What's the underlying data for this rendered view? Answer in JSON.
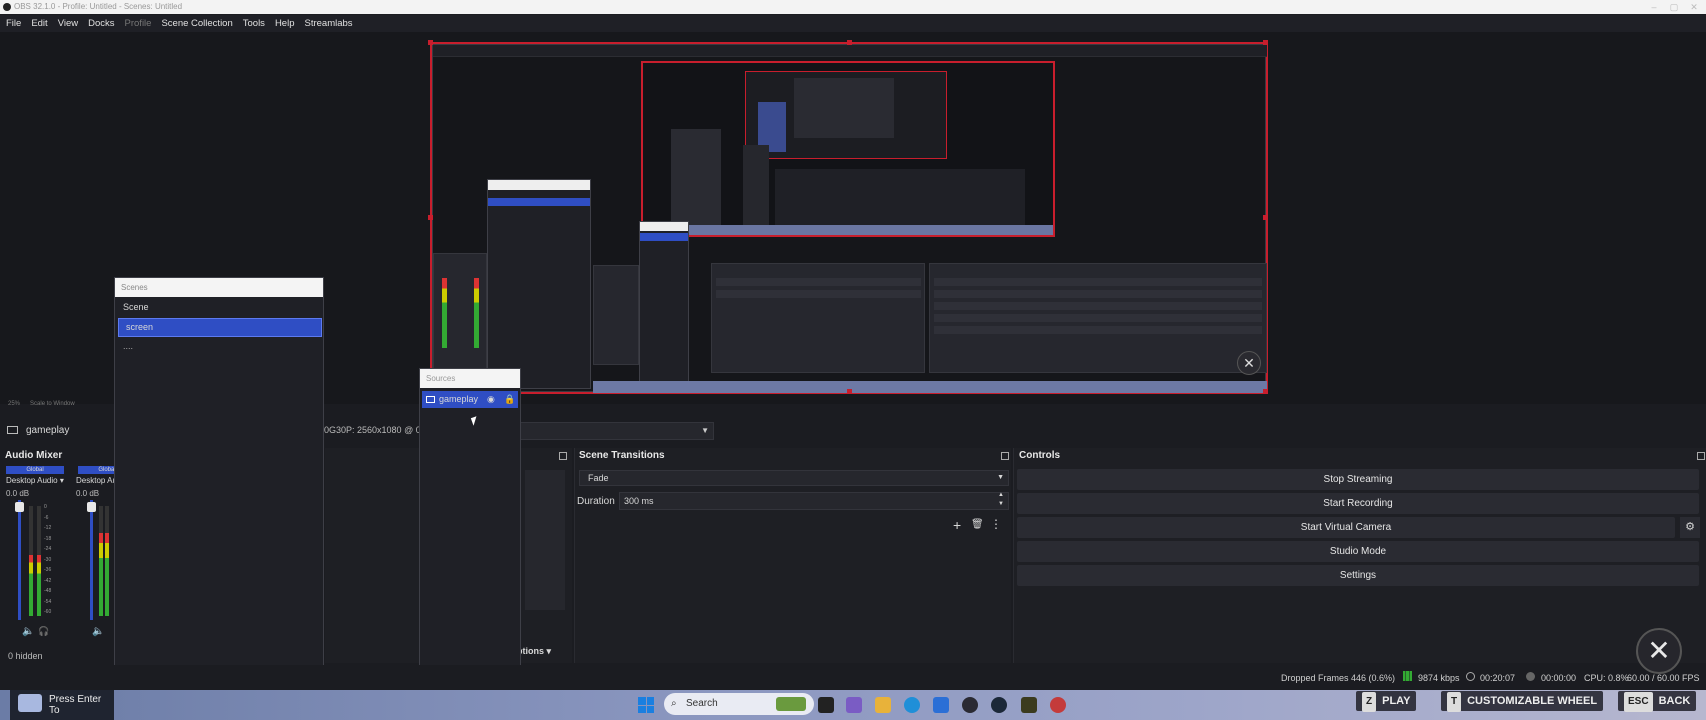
{
  "window": {
    "title": "OBS 32.1.0 - Profile: Untitled - Scenes: Untitled"
  },
  "menu": [
    "File",
    "Edit",
    "View",
    "Docks",
    "Profile",
    "Scene Collection",
    "Tools",
    "Help",
    "Streamlabs"
  ],
  "preview": {
    "zoom": "25%",
    "scale_label": "Scale to Window"
  },
  "scene_bar": {
    "current_scene": "gameplay",
    "source_info": "0G30P: 2560x1080 @ 0.0"
  },
  "audio_mixer": {
    "title": "Audio Mixer",
    "channels": [
      {
        "group": "Global",
        "name": "Desktop Audio",
        "db": "0.0 dB",
        "level": 0.55
      },
      {
        "group": "Global",
        "name": "Desktop Au",
        "db": "0.0 dB",
        "level": 0.75
      }
    ],
    "scale": [
      "0",
      "-6",
      "-12",
      "-18",
      "-24",
      "-30",
      "-36",
      "-42",
      "-48",
      "-54",
      "-60"
    ],
    "hidden": "0 hidden"
  },
  "scenes_window": {
    "title": "Scenes",
    "items": [
      "Scene",
      "screen",
      "...."
    ],
    "selected": 1
  },
  "sources_window": {
    "title": "Sources",
    "items": [
      {
        "name": "gameplay"
      }
    ],
    "options_label": "ptions"
  },
  "scene_transitions": {
    "title": "Scene Transitions",
    "transition": "Fade",
    "duration_label": "Duration",
    "duration_value": "300 ms"
  },
  "controls": {
    "title": "Controls",
    "buttons": [
      "Stop Streaming",
      "Start Recording",
      "Start Virtual Camera",
      "Studio Mode",
      "Settings"
    ]
  },
  "status": {
    "dropped_frames": "Dropped Frames 446 (0.6%)",
    "bitrate": "9874 kbps",
    "stream_time": "00:20:07",
    "rec_time": "00:00:00",
    "cpu": "CPU: 0.8%",
    "fps": "60.00 / 60.00 FPS"
  },
  "taskbar": {
    "press_enter": "Press Enter To",
    "search_placeholder": "Search"
  },
  "overlay": {
    "play_key": "Z",
    "play": "PLAY",
    "wheel_key": "T",
    "wheel": "CUSTOMIZABLE WHEEL",
    "back_key": "ESC",
    "back": "BACK"
  },
  "colors": {
    "accent": "#2f4ec4",
    "selection": "#c81e2d",
    "panel": "#1b1c21"
  }
}
